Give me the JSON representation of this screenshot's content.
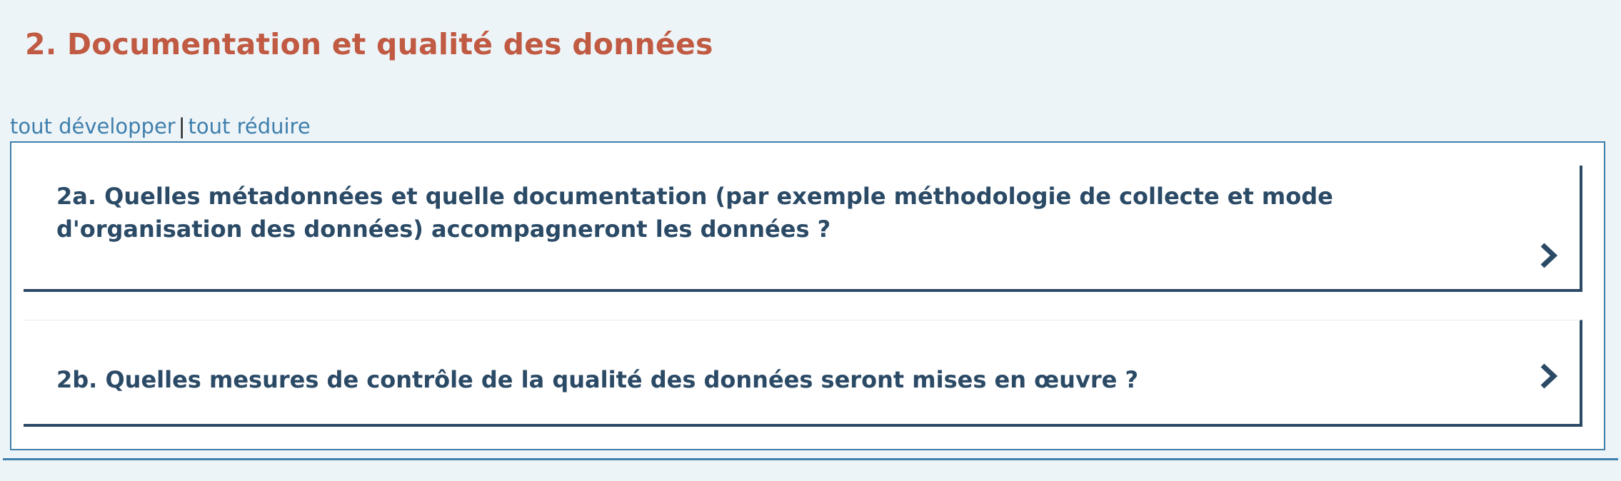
{
  "section": {
    "title": "2. Documentation et qualité des données"
  },
  "toggles": {
    "expand_all": "tout développer",
    "separator": "|",
    "collapse_all": "tout réduire"
  },
  "questions": [
    {
      "text": "2a. Quelles métadonnées et quelle documentation (par exemple méthodologie de collecte et mode d'organisation des données) accompagneront les données ?",
      "icon": "chevron-right-icon"
    },
    {
      "text": "2b. Quelles mesures de contrôle de la qualité des données seront mises en œuvre ?",
      "icon": "chevron-right-icon"
    }
  ],
  "colors": {
    "title": "#c05a42",
    "link": "#3e7fac",
    "question_text": "#2b4a66",
    "background": "#edf4f8"
  }
}
